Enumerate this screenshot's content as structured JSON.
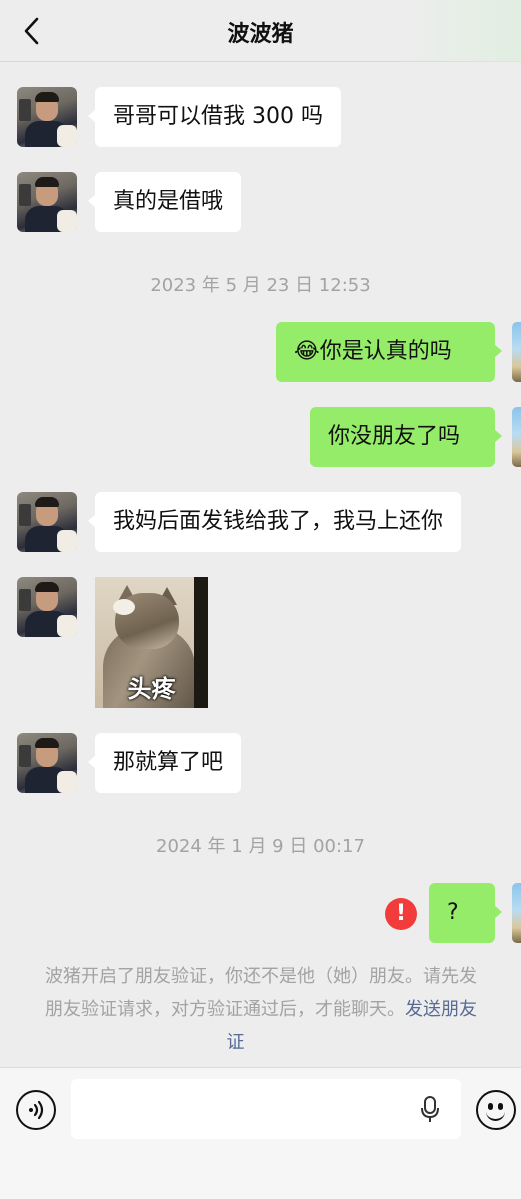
{
  "header": {
    "title": "波波猪"
  },
  "messages": {
    "m1": "哥哥可以借我 300 吗",
    "m2": "真的是借哦",
    "ts1": "2023 年 5 月 23 日 12:53",
    "m3_emoji": "😂",
    "m3": "你是认真的吗",
    "m4": "你没朋友了吗",
    "m5": "我妈后面发钱给我了，我马上还你",
    "sticker_caption": "头疼",
    "m6": "那就算了吧",
    "ts2": "2024 年 1 月 9 日 00:17",
    "m7": "?"
  },
  "notice": {
    "line1": "波猪开启了朋友验证，你还不是他（她）朋友。请先发",
    "line2_text": "朋友验证请求，对方验证通过后，才能聊天。",
    "line2_link": "发送朋友",
    "line3_link": "证"
  },
  "error": {
    "symbol": "!"
  },
  "colors": {
    "background": "#ededed",
    "outgoing_bubble": "#95ec69",
    "incoming_bubble": "#ffffff",
    "link": "#576b95",
    "error": "#f23c3c"
  },
  "icons": [
    "back-icon",
    "voice-icon",
    "microphone-icon",
    "emoji-icon",
    "error-icon"
  ]
}
